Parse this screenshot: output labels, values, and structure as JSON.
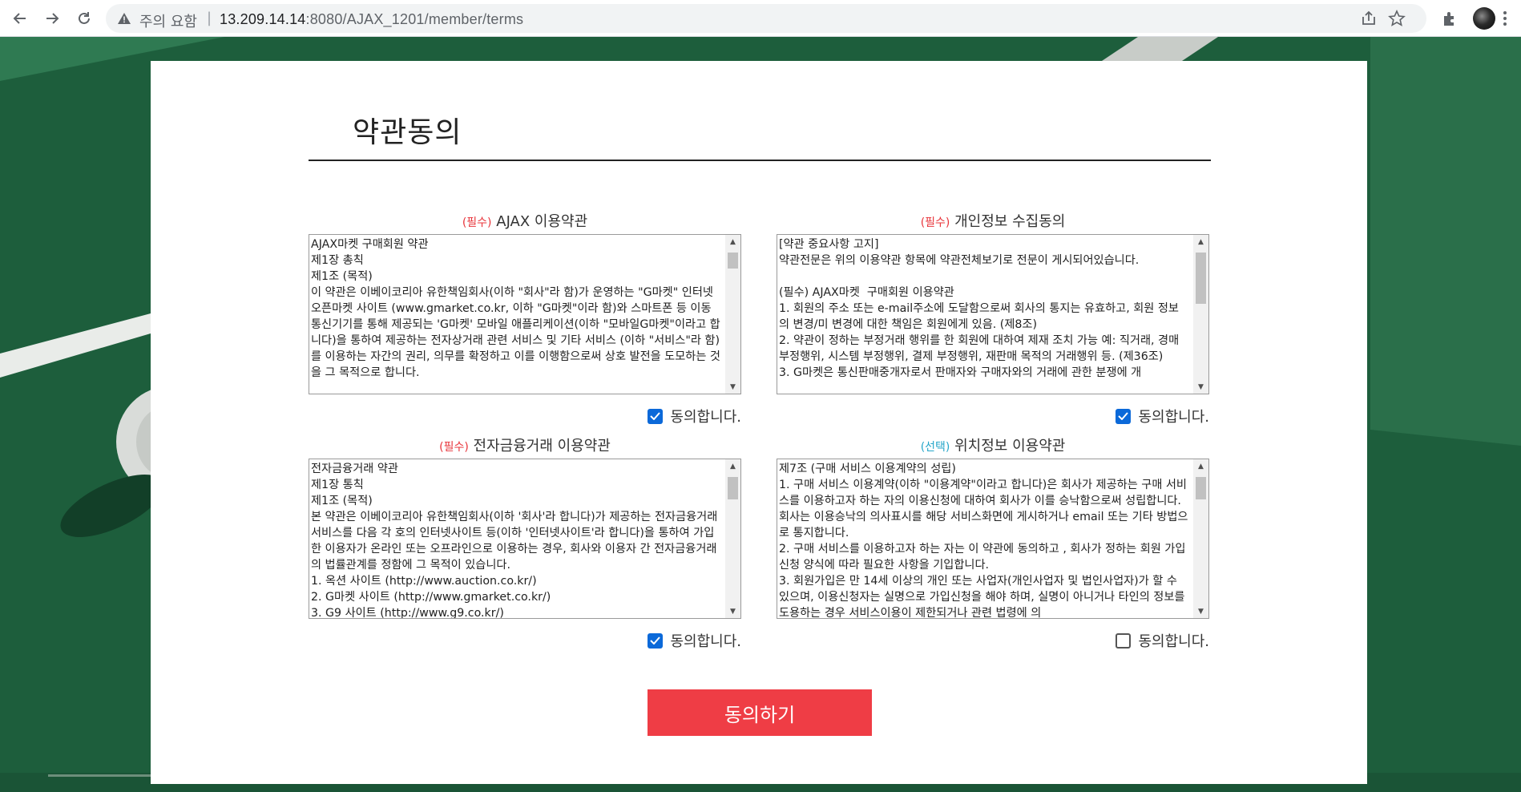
{
  "browser": {
    "security_label": "주의 요함",
    "url_host": "13.209.14.14",
    "url_path": ":8080/AJAX_1201/member/terms"
  },
  "page": {
    "title": "약관동의",
    "submit_label": "동의하기",
    "agree_label": "동의합니다."
  },
  "sections": [
    {
      "tag": "(필수)",
      "tag_kind": "required",
      "title": "AJAX 이용약관",
      "checked": true,
      "scroll_position": 0.0,
      "body": "AJAX마켓 구매회원 약관\n제1장 총칙\n제1조 (목적)\n이 약관은 이베이코리아 유한책임회사(이하 \"회사\"라 함)가 운영하는 \"G마켓\" 인터넷 오픈마켓 사이트 (www.gmarket.co.kr, 이하 \"G마켓\"이라 함)와 스마트폰 등 이동통신기기를 통해 제공되는 'G마켓' 모바일 애플리케이션(이하 \"모바일G마켓\"이라고 합니다)을 통하여 제공하는 전자상거래 관련 서비스 및 기타 서비스 (이하 \"서비스\"라 함)를 이용하는 자간의 권리, 의무를 확정하고 이를 이행함으로써 상호 발전을 도모하는 것을 그 목적으로 합니다."
    },
    {
      "tag": "(필수)",
      "tag_kind": "required",
      "title": "개인정보 수집동의",
      "checked": true,
      "scroll_position": 0.0,
      "body": "[약관 중요사항 고지]\n약관전문은 위의 이용약관 항목에 약관전체보기로 전문이 게시되어있습니다.\n\n(필수) AJAX마켓  구매회원 이용약관\n1. 회원의 주소 또는 e-mail주소에 도달함으로써 회사의 통지는 유효하고, 회원 정보의 변경/미 변경에 대한 책임은 회원에게 있음. (제8조)\n2. 약관이 정하는 부정거래 행위를 한 회원에 대하여 제재 조치 가능 예: 직거래, 경매 부정행위, 시스템 부정행위, 결제 부정행위, 재판매 목적의 거래행위 등. (제36조)\n3. G마켓은 통신판매중개자로서 판매자와 구매자와의 거래에 관한 분쟁에 개"
    },
    {
      "tag": "(필수)",
      "tag_kind": "required",
      "title": "전자금융거래 이용약관",
      "checked": true,
      "scroll_position": 0.0,
      "body": "전자금융거래 약관\n제1장 통칙\n제1조 (목적)\n본 약관은 이베이코리아 유한책임회사(이하 '회사'라 합니다)가 제공하는 전자금융거래서비스를 다음 각 호의 인터넷사이트 등(이하 '인터넷사이트'라 합니다)을 통하여 가입한 이용자가 온라인 또는 오프라인으로 이용하는 경우, 회사와 이용자 간 전자금융거래의 법률관계를 정함에 그 목적이 있습니다.\n1. 옥션 사이트 (http://www.auction.co.kr/)\n2. G마켓 사이트 (http://www.gmarket.co.kr/)\n3. G9 사이트 (http://www.g9.co.kr/)"
    },
    {
      "tag": "(선택)",
      "tag_kind": "optional",
      "title": "위치정보 이용약관",
      "checked": false,
      "scroll_position": 0.0,
      "body": "제7조 (구매 서비스 이용계약의 성립)\n1. 구매 서비스 이용계약(이하 \"이용계약\"이라고 합니다)은 회사가 제공하는 구매 서비스를 이용하고자 하는 자의 이용신청에 대하여 회사가 이를 승낙함으로써 성립합니다. 회사는 이용승낙의 의사표시를 해당 서비스화면에 게시하거나 email 또는 기타 방법으로 통지합니다.\n2. 구매 서비스를 이용하고자 하는 자는 이 약관에 동의하고 , 회사가 정하는 회원 가입 신청 양식에 따라 필요한 사항을 기입합니다.\n3. 회원가입은 만 14세 이상의 개인 또는 사업자(개인사업자 및 법인사업자)가 할 수 있으며, 이용신청자는 실명으로 가입신청을 해야 하며, 실명이 아니거나 타인의 정보를 도용하는 경우 서비스이용이 제한되거나 관련 법령에 의"
    }
  ],
  "colors": {
    "background": "#1d5e3c",
    "required_tag": "#e8343a",
    "optional_tag": "#26a6c9",
    "checkbox": "#0b69d9",
    "submit": "#ef3d45"
  }
}
